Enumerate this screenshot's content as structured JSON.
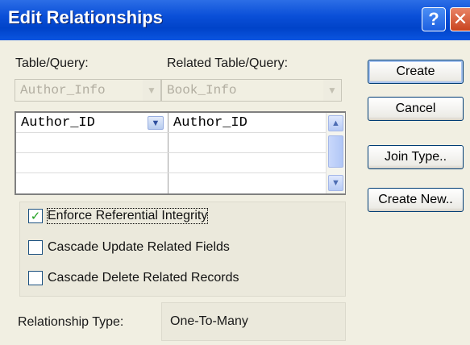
{
  "window": {
    "title": "Edit Relationships",
    "help_glyph": "?",
    "close_glyph": "✕"
  },
  "table_query": {
    "label": "Table/Query:",
    "value": "Author_Info"
  },
  "related_table_query": {
    "label": "Related Table/Query:",
    "value": "Book_Info"
  },
  "grid": {
    "rows": [
      {
        "left": "Author_ID",
        "right": "Author_ID"
      },
      {
        "left": "",
        "right": ""
      },
      {
        "left": "",
        "right": ""
      },
      {
        "left": "",
        "right": ""
      }
    ]
  },
  "options": {
    "enforce_integrity": {
      "label": "Enforce Referential Integrity",
      "checked": true
    },
    "cascade_update": {
      "label": "Cascade Update Related Fields",
      "checked": false
    },
    "cascade_delete": {
      "label": "Cascade Delete Related Records",
      "checked": false
    }
  },
  "relationship_type": {
    "label": "Relationship Type:",
    "value": "One-To-Many"
  },
  "buttons": {
    "create": "Create",
    "cancel": "Cancel",
    "join_type": "Join Type..",
    "create_new": "Create New.."
  },
  "icons": {
    "check": "✓",
    "dropdown": "▼",
    "scroll_up": "▲",
    "scroll_down": "▼"
  }
}
